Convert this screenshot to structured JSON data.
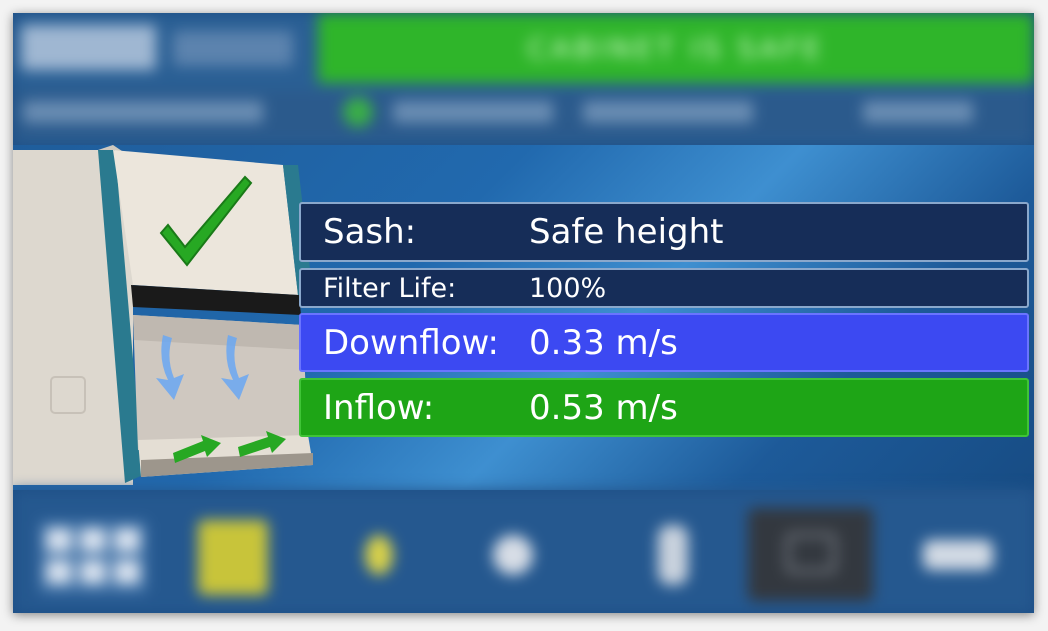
{
  "header": {
    "status_banner": "CABINET IS SAFE"
  },
  "status_rows": [
    {
      "label": "Sash:",
      "value": "Safe height",
      "color": "#162d58"
    },
    {
      "label": "Filter Life:",
      "value": "100%",
      "color": "#162d58"
    },
    {
      "label": "Downflow:",
      "value": "0.33 m/s",
      "color": "#3c49f2"
    },
    {
      "label": "Inflow:",
      "value": "0.53 m/s",
      "color": "#1ea516"
    }
  ],
  "cabinet": {
    "state_icon": "checkmark-icon",
    "airflow_icons": [
      "downflow-arrow-icon",
      "inflow-arrow-icon"
    ]
  },
  "toolbar": {
    "icons": [
      "apps-grid-icon",
      "yellow-square-icon",
      "lightbulb-icon",
      "power-outlet-icon",
      "uv-lamp-icon",
      "window-icon",
      "settings-icon"
    ]
  },
  "colors": {
    "background": "#1d4f86",
    "status_green": "#2fb52a",
    "downflow_blue": "#3c49f2",
    "inflow_green": "#1ea516"
  }
}
